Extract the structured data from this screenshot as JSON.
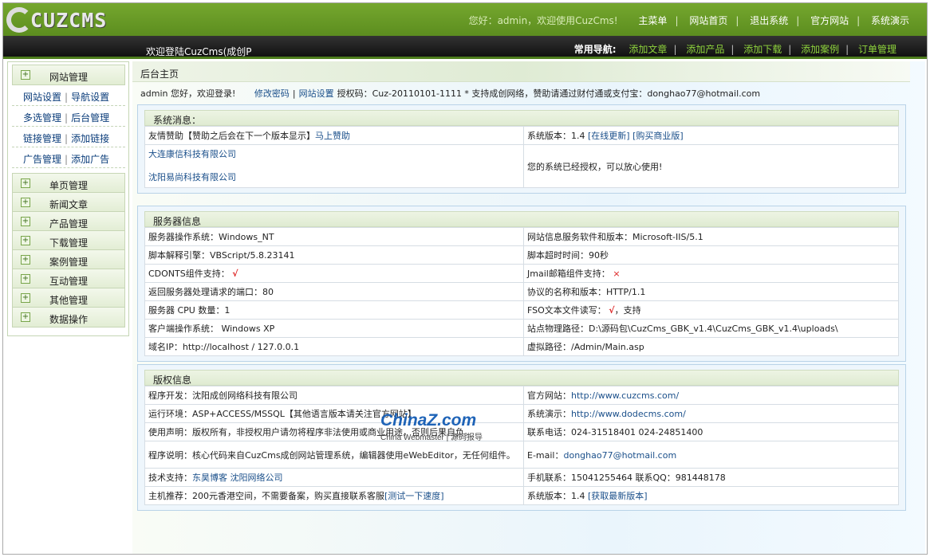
{
  "logo": {
    "text": "CUZCMS"
  },
  "topnav": {
    "greeting": "您好：admin，欢迎使用CuzCms!",
    "items": [
      "主菜单",
      "网站首页",
      "退出系统",
      "官方网站",
      "系统演示"
    ]
  },
  "bar": {
    "welcome": "欢迎登陆CuzCms(成创P",
    "quick_label": "常用导航:",
    "quick_links": [
      "添加文章",
      "添加产品",
      "添加下载",
      "添加案例",
      "订单管理"
    ]
  },
  "sidebar": {
    "site_manage": "网站管理",
    "sub": [
      [
        "网站设置",
        "导航设置"
      ],
      [
        "多选管理",
        "后台管理"
      ],
      [
        "链接管理",
        "添加链接"
      ],
      [
        "广告管理",
        "添加广告"
      ]
    ],
    "sections": [
      "单页管理",
      "新闻文章",
      "产品管理",
      "下载管理",
      "案例管理",
      "互动管理",
      "其他管理",
      "数据操作"
    ]
  },
  "crumb": "后台主页",
  "userline": {
    "prefix": "admin 您好，欢迎登录!",
    "change_pwd": "修改密码",
    "settings": "网站设置",
    "suffix": "授权码：Cuz-20110101-1111 * 支持成创网络，赞助请通过财付通或支付宝：donghao77@hotmail.com"
  },
  "sysmsg": {
    "title": "系统消息：",
    "sponsor_text": "友情赞助【赞助之后会在下一个版本显示】",
    "sponsor_link": "马上赞助",
    "version_text": "系统版本：1.4",
    "update_link": "[在线更新]",
    "buy_link": "[购买商业版]",
    "company1": "大连康信科技有限公司",
    "company2": "沈阳易尚科技有限公司",
    "auth_text": "您的系统已经授权，可以放心使用!"
  },
  "server": {
    "title": "服务器信息",
    "rows": [
      [
        "服务器操作系统：Windows_NT",
        "网站信息服务软件和版本：Microsoft-IIS/5.1"
      ],
      [
        "脚本解释引擎：VBScript/5.8.23141",
        "脚本超时时间：90秒"
      ],
      [
        "CDONTS组件支持：",
        "Jmail邮箱组件支持："
      ],
      [
        "返回服务器处理请求的端口：80",
        "协议的名称和版本：HTTP/1.1"
      ],
      [
        "服务器 CPU 数量：1",
        "FSO文本文件读写："
      ],
      [
        "客户端操作系统： Windows XP",
        "站点物理路径：D:\\源码包\\CuzCms_GBK_v1.4\\CuzCms_GBK_v1.4\\uploads\\"
      ],
      [
        "域名IP：http://localhost / 127.0.0.1",
        "虚拟路径：/Admin/Main.asp"
      ]
    ],
    "check": "√",
    "cross": "×",
    "fso_suffix": "，支持"
  },
  "copyright": {
    "title": "版权信息",
    "dev": "程序开发：沈阳成创网络科技有限公司",
    "site_label": "官方网站：",
    "site_url": "http://www.cuzcms.com/",
    "env": "运行环境：ASP+ACCESS/MSSQL【其他语言版本请关注官方网站】",
    "demo_label": "系统演示：",
    "demo_url": "http://www.dodecms.com/",
    "notice": "使用声明：版权所有，非授权用户请勿将程序非法使用或商业用途，否则后果自负。",
    "phone": "联系电话：024-31518401 024-24851400",
    "desc": "程序说明：核心代码来自CuzCms成创网站管理系统，编辑器使用eWebEditor，无任何组件。",
    "email_label": "E-mail：",
    "email": "donghao77@hotmail.com",
    "support_label": "技术支持：",
    "support_links": [
      "东昊博客",
      "沈阳网络公司"
    ],
    "mobile": "手机联系：15041255464 联系QQ：981448178",
    "host": "主机推荐：200元香港空间，不需要备案，购买直接联系客服",
    "host_link": "[测试一下速度]",
    "ver_text": "系统版本：1.4",
    "latest_link": "[获取最新版本]"
  },
  "watermark": {
    "big": "ChinaZ.com",
    "small": "China Webmaster | 源码报导"
  }
}
